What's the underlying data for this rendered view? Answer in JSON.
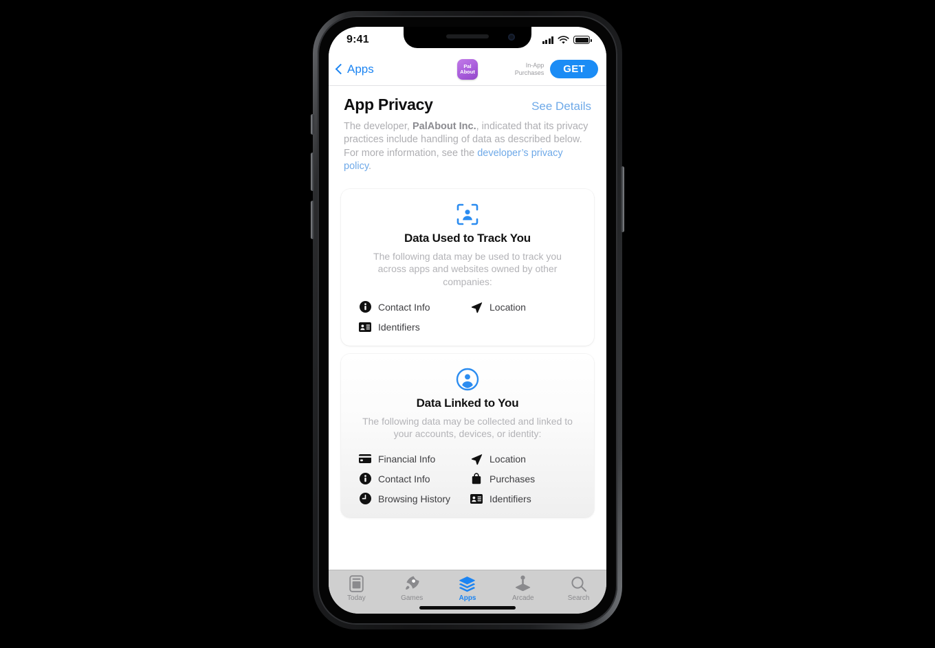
{
  "status_bar": {
    "time": "9:41",
    "signal_icon": "cellular-bars-icon",
    "wifi_icon": "wifi-icon",
    "battery_icon": "battery-full-icon"
  },
  "nav_bar": {
    "back_label": "Apps",
    "back_icon": "chevron-left-icon",
    "app_icon_line1": "Pal",
    "app_icon_line2": "About",
    "in_app_purchases_line1": "In-App",
    "in_app_purchases_line2": "Purchases",
    "get_label": "GET"
  },
  "section": {
    "title": "App Privacy",
    "see_details_label": "See Details",
    "blurb_part1": "The developer, ",
    "blurb_developer": "PalAbout Inc.",
    "blurb_part2": ", indicated that its privacy practices include handling of data as described below. For more information, see the ",
    "blurb_link": "developer’s privacy policy",
    "blurb_end": "."
  },
  "cards": [
    {
      "icon": "person-in-viewfinder-icon",
      "title": "Data Used to Track You",
      "subtitle": "The following data may be used to track you across apps and websites owned by other companies:",
      "items": [
        {
          "icon": "info-circle-icon",
          "label": "Contact Info"
        },
        {
          "icon": "location-arrow-icon",
          "label": "Location"
        },
        {
          "icon": "contact-card-icon",
          "label": "Identifiers"
        }
      ]
    },
    {
      "icon": "person-circle-icon",
      "title": "Data Linked to You",
      "subtitle": "The following data may be collected and linked to your accounts, devices, or identity:",
      "items": [
        {
          "icon": "credit-card-icon",
          "label": "Financial Info"
        },
        {
          "icon": "location-arrow-icon",
          "label": "Location"
        },
        {
          "icon": "info-circle-icon",
          "label": "Contact Info"
        },
        {
          "icon": "shopping-bag-icon",
          "label": "Purchases"
        },
        {
          "icon": "clock-icon",
          "label": "Browsing History"
        },
        {
          "icon": "contact-card-icon",
          "label": "Identifiers"
        }
      ]
    }
  ],
  "tab_bar": {
    "tabs": [
      {
        "icon": "today-icon",
        "label": "Today",
        "active": false
      },
      {
        "icon": "rocket-icon",
        "label": "Games",
        "active": false
      },
      {
        "icon": "layers-icon",
        "label": "Apps",
        "active": true
      },
      {
        "icon": "joystick-icon",
        "label": "Arcade",
        "active": false
      },
      {
        "icon": "search-icon",
        "label": "Search",
        "active": false
      }
    ]
  },
  "colors": {
    "accent_blue": "#1b84f2",
    "link_blue": "#6ea9e8",
    "get_button": "#1b8cf5",
    "app_icon_purple": "#a85ddb",
    "tab_bar_bg": "#cfcfcf",
    "muted_text": "#b3b3b7"
  }
}
